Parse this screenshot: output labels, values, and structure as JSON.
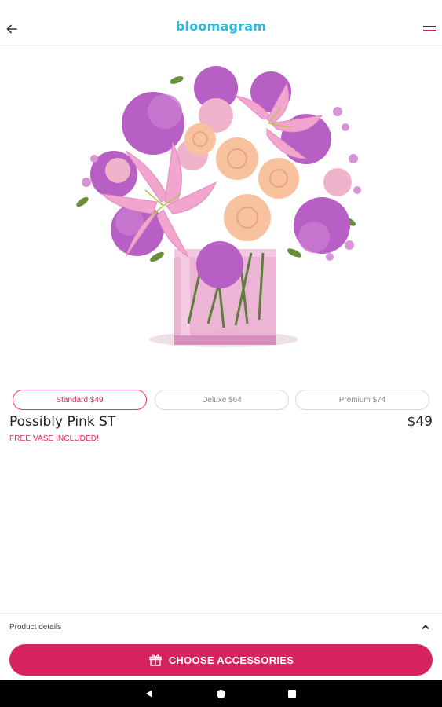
{
  "header": {
    "brand": "bloomagram",
    "back_icon": "arrow-left-icon",
    "menu_icon": "hamburger-menu-icon"
  },
  "product": {
    "image_alt": "Pink lilies, peach roses and purple mums in a pink glass cube vase",
    "options": [
      {
        "label": "Standard $49",
        "selected": true
      },
      {
        "label": "Deluxe $64",
        "selected": false
      },
      {
        "label": "Premium $74",
        "selected": false
      }
    ],
    "name": "Possibly Pink ST",
    "price": "$49",
    "promo": "FREE VASE INCLUDED!"
  },
  "details": {
    "label": "Product details",
    "chevron_icon": "chevron-up-icon"
  },
  "cta": {
    "label": "CHOOSE ACCESSORIES",
    "icon": "gift-box-icon"
  },
  "system_nav": {
    "back_icon": "nav-back-icon",
    "home_icon": "nav-home-icon",
    "recents_icon": "nav-recents-icon"
  },
  "colors": {
    "brand": "#27bde3",
    "accent": "#d7245f",
    "promo": "#e0246a"
  }
}
